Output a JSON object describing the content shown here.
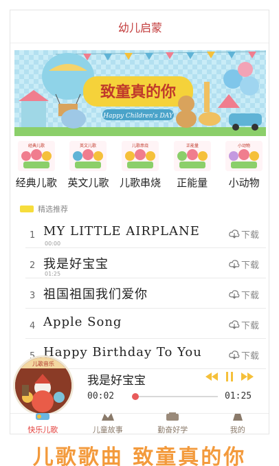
{
  "header": {
    "title": "幼儿启蒙"
  },
  "banner": {
    "headline": "致童真的你",
    "ribbon": "Happy Children's DAY"
  },
  "categories": [
    {
      "label": "经典儿歌",
      "thumb_text": "经典儿歌"
    },
    {
      "label": "英文儿歌",
      "thumb_text": "英文儿歌"
    },
    {
      "label": "儿歌串烧",
      "thumb_text": "儿歌串烧"
    },
    {
      "label": "正能量",
      "thumb_text": "正能量"
    },
    {
      "label": "小动物",
      "thumb_text": "小动物"
    }
  ],
  "section": {
    "title": "精选推荐"
  },
  "songs": [
    {
      "num": "1",
      "title": "MY LITTLE AIRPLANE",
      "meta": "00:00",
      "download": "下载"
    },
    {
      "num": "2",
      "title": "我是好宝宝",
      "meta": "01:25",
      "download": "下载"
    },
    {
      "num": "3",
      "title": "祖国祖国我们爱你",
      "meta": "",
      "download": "下载"
    },
    {
      "num": "4",
      "title": "Apple Song",
      "meta": "",
      "download": "下载"
    },
    {
      "num": "5",
      "title": "Happy Birthday To You",
      "meta": "",
      "download": "下载"
    }
  ],
  "player": {
    "now_playing": "我是好宝宝",
    "disc_label": "儿歌音乐",
    "current_time": "00:02",
    "total_time": "01:25",
    "progress": 0.03
  },
  "tabs": [
    {
      "label": "快乐儿歌",
      "active": true
    },
    {
      "label": "儿童故事",
      "active": false
    },
    {
      "label": "勤奋好学",
      "active": false
    },
    {
      "label": "我的",
      "active": false
    }
  ],
  "caption": {
    "text": "儿歌歌曲 致童真的你"
  },
  "colors": {
    "accent": "#e3413d",
    "title": "#c23b3b",
    "ctrl": "#f5c03a",
    "caption": "#f39a3c"
  }
}
